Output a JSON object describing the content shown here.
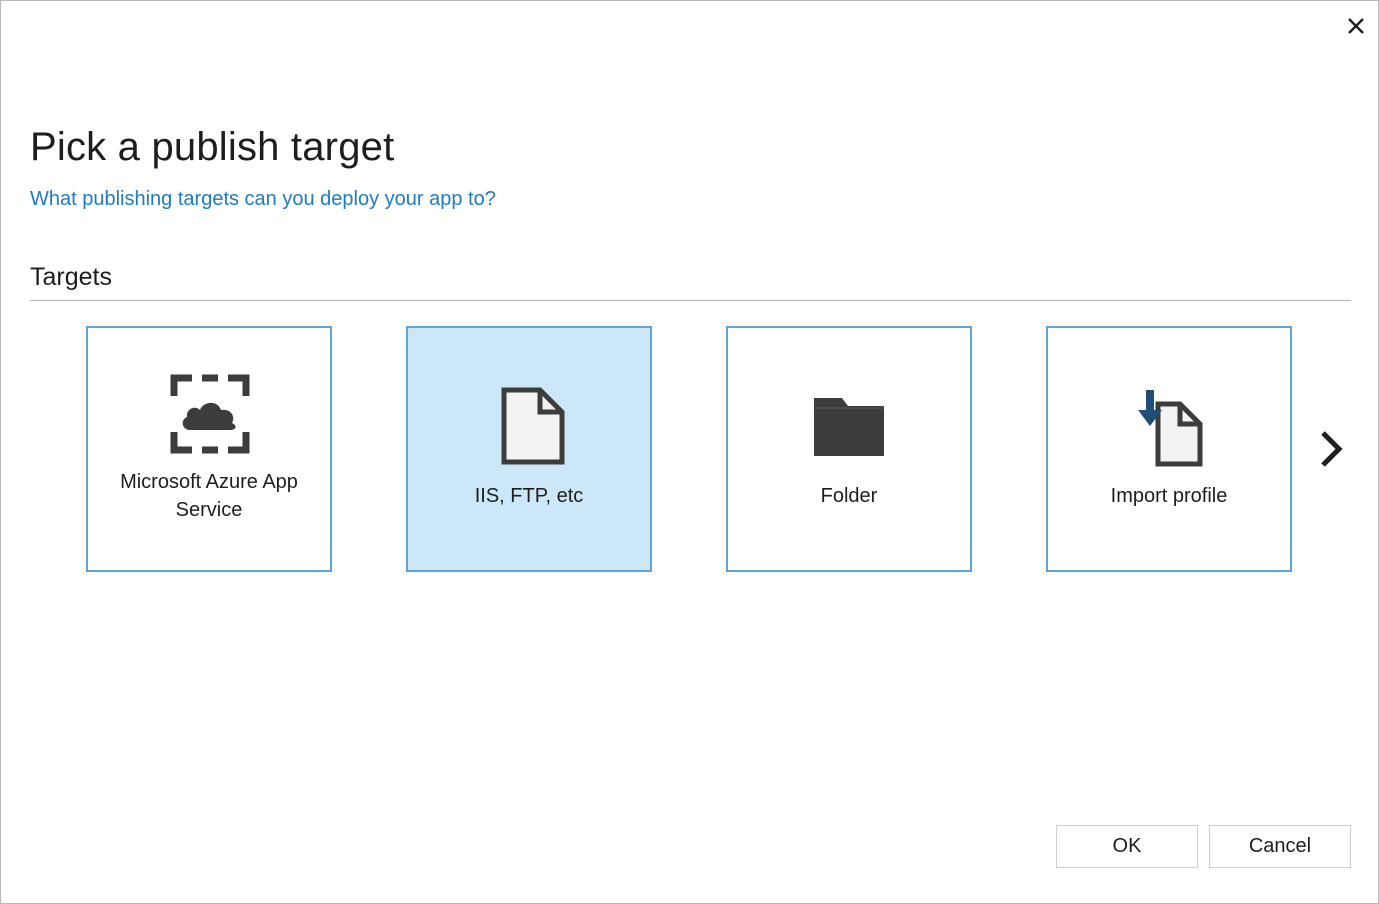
{
  "dialog": {
    "title": "Pick a publish target",
    "help_link": "What publishing targets can you deploy your app to?",
    "section_label": "Targets"
  },
  "targets": [
    {
      "label_line1": "Microsoft Azure App",
      "label_line2": "Service",
      "icon": "azure-app-service-icon",
      "selected": false
    },
    {
      "label": "IIS, FTP, etc",
      "icon": "document-icon",
      "selected": true
    },
    {
      "label": "Folder",
      "icon": "folder-icon",
      "selected": false
    },
    {
      "label": "Import profile",
      "icon": "import-profile-icon",
      "selected": false
    }
  ],
  "buttons": {
    "ok": "OK",
    "cancel": "Cancel"
  },
  "colors": {
    "accent": "#1e7bc7",
    "tile_border": "#5aa6dd",
    "selected_tile": "#cce7f7",
    "icon_dark": "#3c3c3c",
    "import_arrow": "#1f4e79"
  }
}
